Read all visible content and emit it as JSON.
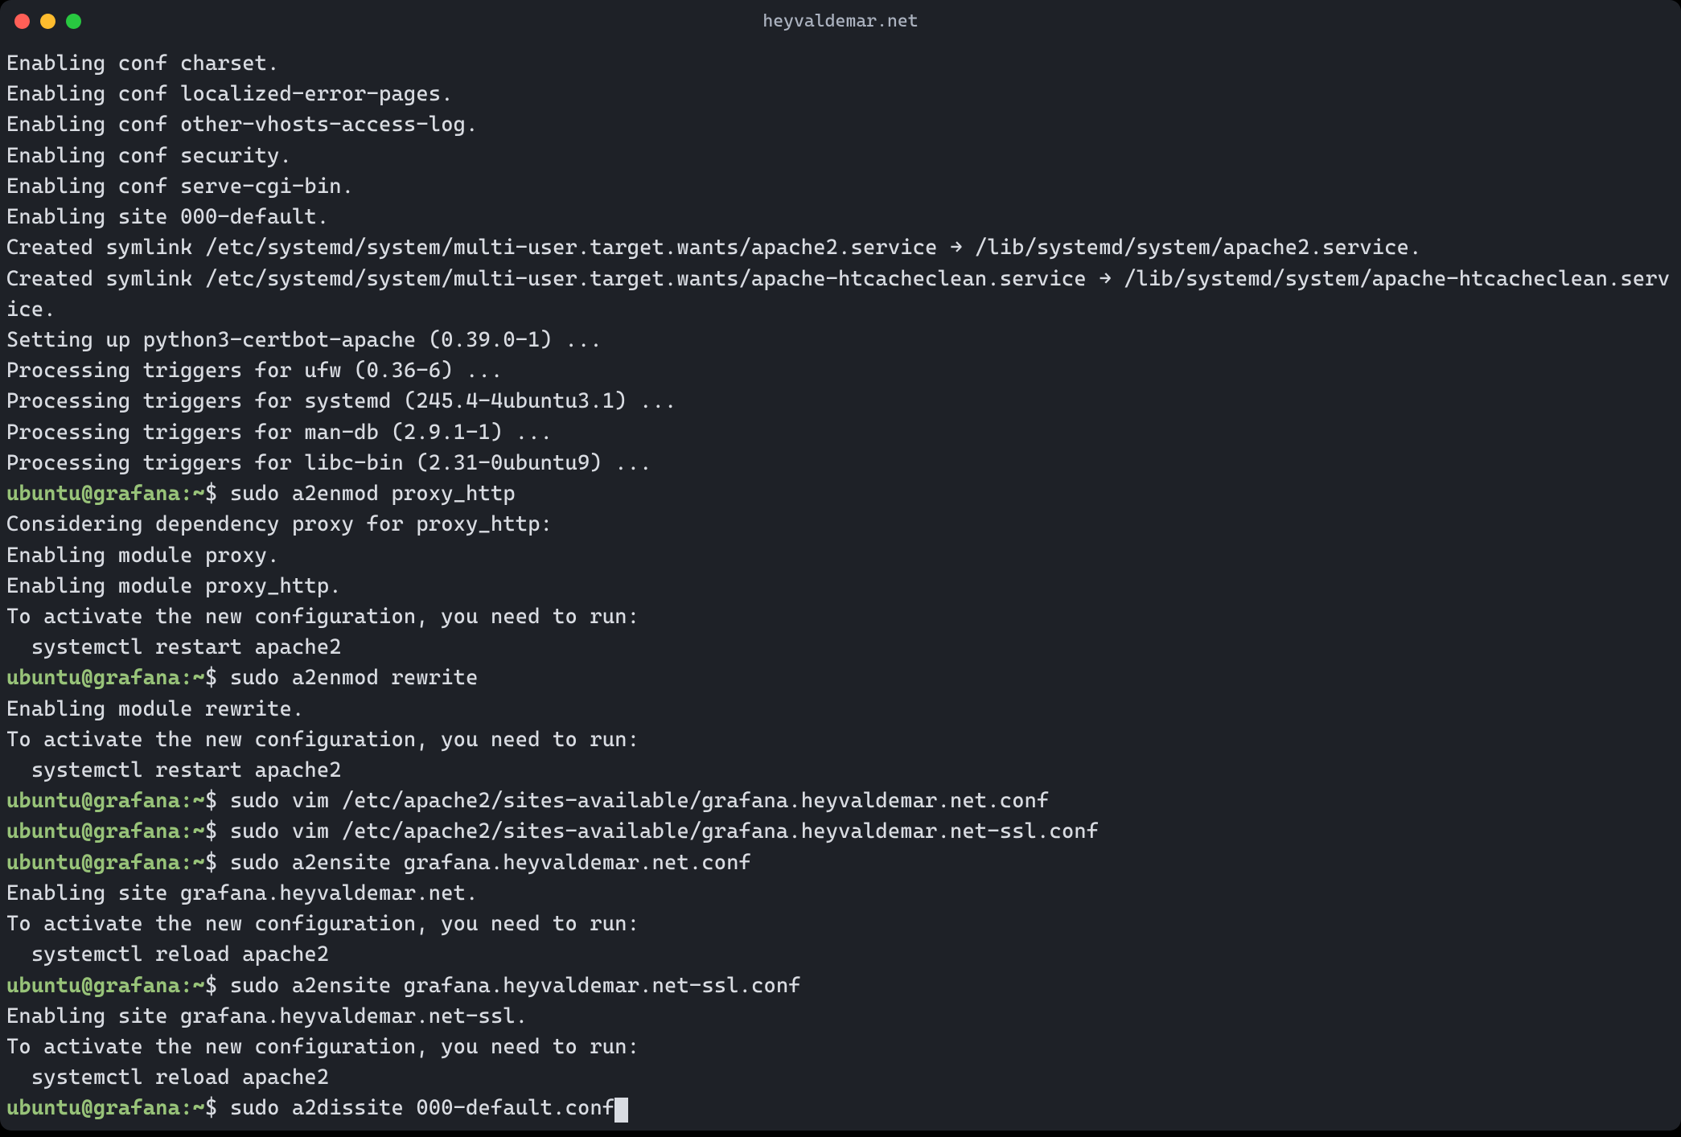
{
  "window": {
    "title": "heyvaldemar.net"
  },
  "prompt": {
    "userhost": "ubuntu@grafana",
    "path": "~",
    "symbol": "$"
  },
  "lines": [
    {
      "type": "output",
      "text": "Enabling conf charset."
    },
    {
      "type": "output",
      "text": "Enabling conf localized-error-pages."
    },
    {
      "type": "output",
      "text": "Enabling conf other-vhosts-access-log."
    },
    {
      "type": "output",
      "text": "Enabling conf security."
    },
    {
      "type": "output",
      "text": "Enabling conf serve-cgi-bin."
    },
    {
      "type": "output",
      "text": "Enabling site 000-default."
    },
    {
      "type": "output",
      "text": "Created symlink /etc/systemd/system/multi-user.target.wants/apache2.service → /lib/systemd/system/apache2.service."
    },
    {
      "type": "output",
      "text": "Created symlink /etc/systemd/system/multi-user.target.wants/apache-htcacheclean.service → /lib/systemd/system/apache-htcacheclean.service."
    },
    {
      "type": "output",
      "text": "Setting up python3-certbot-apache (0.39.0-1) ..."
    },
    {
      "type": "output",
      "text": "Processing triggers for ufw (0.36-6) ..."
    },
    {
      "type": "output",
      "text": "Processing triggers for systemd (245.4-4ubuntu3.1) ..."
    },
    {
      "type": "output",
      "text": "Processing triggers for man-db (2.9.1-1) ..."
    },
    {
      "type": "output",
      "text": "Processing triggers for libc-bin (2.31-0ubuntu9) ..."
    },
    {
      "type": "prompt",
      "command": "sudo a2enmod proxy_http"
    },
    {
      "type": "output",
      "text": "Considering dependency proxy for proxy_http:"
    },
    {
      "type": "output",
      "text": "Enabling module proxy."
    },
    {
      "type": "output",
      "text": "Enabling module proxy_http."
    },
    {
      "type": "output",
      "text": "To activate the new configuration, you need to run:"
    },
    {
      "type": "output",
      "text": "  systemctl restart apache2"
    },
    {
      "type": "prompt",
      "command": "sudo a2enmod rewrite"
    },
    {
      "type": "output",
      "text": "Enabling module rewrite."
    },
    {
      "type": "output",
      "text": "To activate the new configuration, you need to run:"
    },
    {
      "type": "output",
      "text": "  systemctl restart apache2"
    },
    {
      "type": "prompt",
      "command": "sudo vim /etc/apache2/sites-available/grafana.heyvaldemar.net.conf"
    },
    {
      "type": "prompt",
      "command": "sudo vim /etc/apache2/sites-available/grafana.heyvaldemar.net-ssl.conf"
    },
    {
      "type": "prompt",
      "command": "sudo a2ensite grafana.heyvaldemar.net.conf"
    },
    {
      "type": "output",
      "text": "Enabling site grafana.heyvaldemar.net."
    },
    {
      "type": "output",
      "text": "To activate the new configuration, you need to run:"
    },
    {
      "type": "output",
      "text": "  systemctl reload apache2"
    },
    {
      "type": "prompt",
      "command": "sudo a2ensite grafana.heyvaldemar.net-ssl.conf"
    },
    {
      "type": "output",
      "text": "Enabling site grafana.heyvaldemar.net-ssl."
    },
    {
      "type": "output",
      "text": "To activate the new configuration, you need to run:"
    },
    {
      "type": "output",
      "text": "  systemctl reload apache2"
    },
    {
      "type": "prompt",
      "command": "sudo a2dissite 000-default.conf",
      "cursor": true
    }
  ]
}
